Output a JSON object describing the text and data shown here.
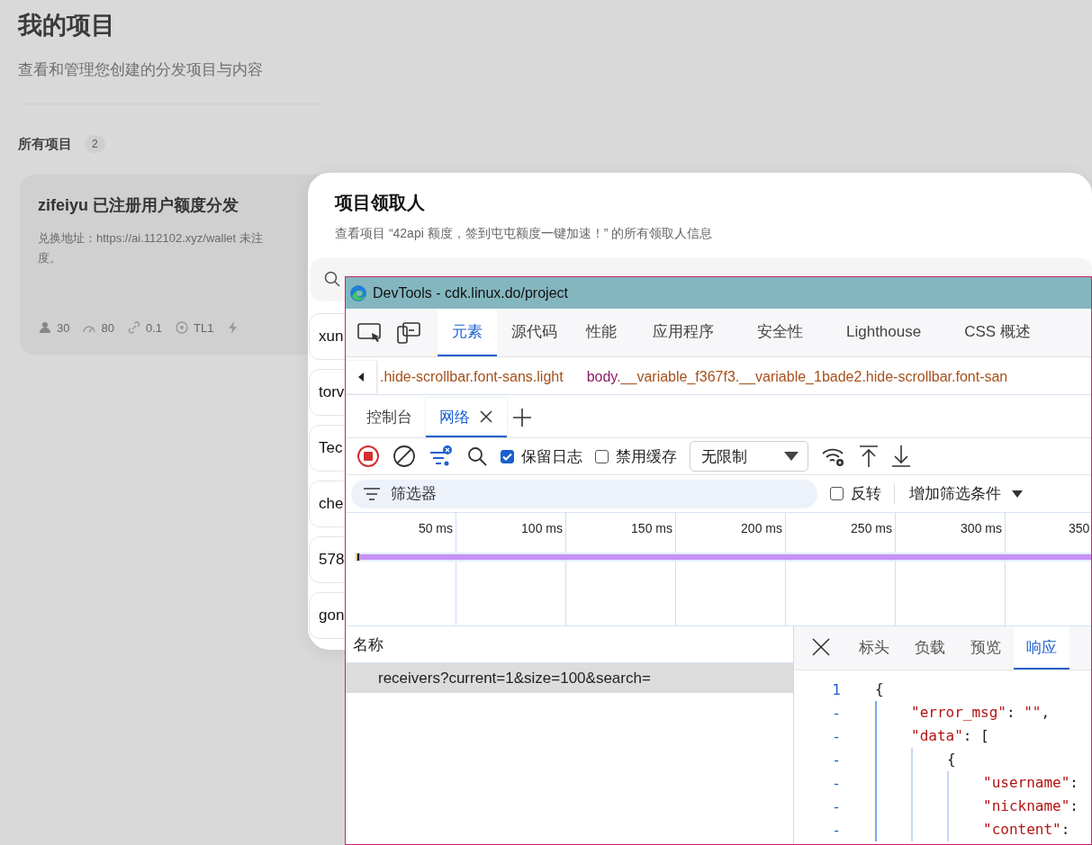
{
  "background_page": {
    "title": "我的项目",
    "subtitle": "查看和管理您创建的分发项目与内容",
    "section": {
      "label": "所有项目",
      "count": "2"
    },
    "cards": [
      {
        "title": "zifeiyu 已注册用户额度分发",
        "description": "兑换地址：https://ai.112102.xyz/wallet 未注",
        "description_more": "度。",
        "stats": [
          {
            "kind": "users",
            "text": "30"
          },
          {
            "kind": "gauge",
            "text": "80"
          },
          {
            "kind": "link",
            "text": "0.1"
          },
          {
            "kind": "level",
            "text": "TL1"
          },
          {
            "kind": "bolt"
          }
        ]
      }
    ]
  },
  "modal": {
    "title": "项目领取人",
    "subtitle": "查看项目 “42api 额度，签到屯屯额度一键加速！” 的所有领取人信息",
    "rows": [
      "xun",
      "torv",
      "Tec",
      "che",
      "578",
      "gon"
    ]
  },
  "devtools": {
    "title": "DevTools - cdk.linux.do/project",
    "tabs": [
      {
        "label": "元素",
        "selected": true
      },
      {
        "label": "源代码",
        "selected": false
      },
      {
        "label": "性能",
        "selected": false
      },
      {
        "label": "应用程序",
        "selected": false
      },
      {
        "label": "安全性",
        "selected": false
      },
      {
        "label": "Lighthouse",
        "selected": false
      },
      {
        "label": "CSS 概述",
        "selected": false
      }
    ],
    "breadcrumbs": [
      {
        "kind": "class",
        "text": ".hide-scrollbar.font-sans.light"
      },
      {
        "kind": "element",
        "tag": "body",
        "text": ".__variable_f367f3.__variable_1bade2.hide-scrollbar.font-san"
      }
    ],
    "drawer_tabs": [
      {
        "label": "控制台",
        "selected": false,
        "closable": false
      },
      {
        "label": "网络",
        "selected": true,
        "closable": true
      }
    ],
    "toolbar": {
      "recording": true,
      "preserve_log": {
        "label": "保留日志",
        "checked": true
      },
      "disable_cache": {
        "label": "禁用缓存",
        "checked": false
      },
      "throttle": "无限制"
    },
    "filter": {
      "placeholder": "筛选器",
      "invert": {
        "label": "反转",
        "checked": false
      },
      "more_filters": "增加筛选条件"
    },
    "timeline": {
      "ticks": [
        "50 ms",
        "100 ms",
        "150 ms",
        "200 ms",
        "250 ms",
        "300 ms",
        "350"
      ]
    },
    "requests": {
      "column": "名称",
      "rows": [
        {
          "name": "receivers?current=1&size=100&search=",
          "selected": true
        }
      ]
    },
    "detail_tabs": [
      {
        "label": "标头",
        "selected": false
      },
      {
        "label": "负载",
        "selected": false
      },
      {
        "label": "预览",
        "selected": false
      },
      {
        "label": "响应",
        "selected": true
      }
    ],
    "response": [
      {
        "gutter": "1",
        "parts": [
          {
            "kind": "punct",
            "text": "{"
          }
        ],
        "children": [
          {
            "gutter": "-",
            "parts": [
              {
                "kind": "string",
                "text": "\"error_msg\""
              },
              {
                "kind": "punct",
                "text": ": "
              },
              {
                "kind": "string",
                "text": "\"\""
              },
              {
                "kind": "punct",
                "text": ","
              }
            ]
          },
          {
            "gutter": "-",
            "parts": [
              {
                "kind": "string",
                "text": "\"data\""
              },
              {
                "kind": "punct",
                "text": ": ["
              }
            ],
            "children": [
              {
                "gutter": "-",
                "parts": [
                  {
                    "kind": "punct",
                    "text": "{"
                  }
                ],
                "children": [
                  {
                    "gutter": "-",
                    "parts": [
                      {
                        "kind": "string",
                        "text": "\"username\""
                      },
                      {
                        "kind": "punct",
                        "text": ":"
                      }
                    ]
                  },
                  {
                    "gutter": "-",
                    "parts": [
                      {
                        "kind": "string",
                        "text": "\"nickname\""
                      },
                      {
                        "kind": "punct",
                        "text": ":"
                      }
                    ]
                  },
                  {
                    "gutter": "-",
                    "parts": [
                      {
                        "kind": "string",
                        "text": "\"content\""
                      },
                      {
                        "kind": "punct",
                        "text": ":"
                      }
                    ]
                  }
                ]
              }
            ]
          }
        ]
      }
    ]
  }
}
